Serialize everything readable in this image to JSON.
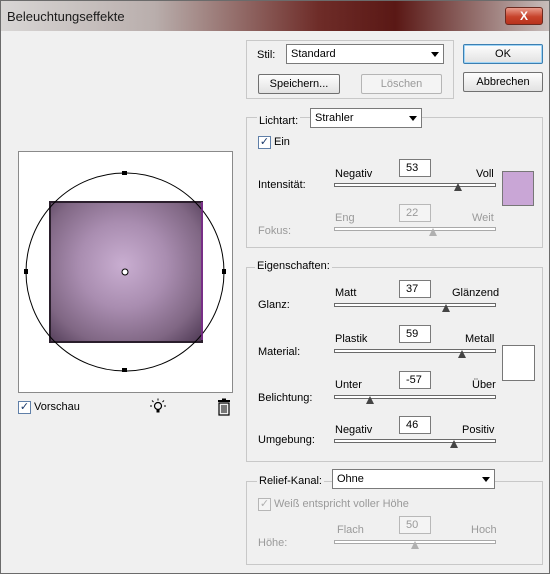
{
  "window": {
    "title": "Beleuchtungseffekte",
    "close_glyph": "X"
  },
  "stil": {
    "label": "Stil:",
    "value": "Standard",
    "save_label": "Speichern...",
    "delete_label": "Löschen"
  },
  "buttons": {
    "ok": "OK",
    "cancel": "Abbrechen"
  },
  "light": {
    "type_label": "Lichtart:",
    "type_value": "Strahler",
    "on_label": "Ein",
    "on_checked": true,
    "intensity": {
      "label": "Intensität:",
      "min_label": "Negativ",
      "max_label": "Voll",
      "value": "53"
    },
    "focus": {
      "label": "Fokus:",
      "min_label": "Eng",
      "max_label": "Weit",
      "value": "22"
    },
    "color": "#c9a6d6"
  },
  "properties": {
    "section_label": "Eigenschaften:",
    "gloss": {
      "label": "Glanz:",
      "min_label": "Matt",
      "max_label": "Glänzend",
      "value": "37"
    },
    "material": {
      "label": "Material:",
      "min_label": "Plastik",
      "max_label": "Metall",
      "value": "59"
    },
    "exposure": {
      "label": "Belichtung:",
      "min_label": "Unter",
      "max_label": "Über",
      "value": "-57"
    },
    "ambience": {
      "label": "Umgebung:",
      "min_label": "Negativ",
      "max_label": "Positiv",
      "value": "46"
    },
    "color": "#ffffff"
  },
  "texture": {
    "channel_label": "Relief-Kanal:",
    "channel_value": "Ohne",
    "white_high_label": "Weiß entspricht voller Höhe",
    "height": {
      "label": "Höhe:",
      "min_label": "Flach",
      "max_label": "Hoch",
      "value": "50"
    }
  },
  "preview": {
    "label": "Vorschau",
    "checked": true,
    "icon_light": "light-bulb-icon",
    "icon_trash": "trash-icon"
  },
  "check_glyph": "✓"
}
